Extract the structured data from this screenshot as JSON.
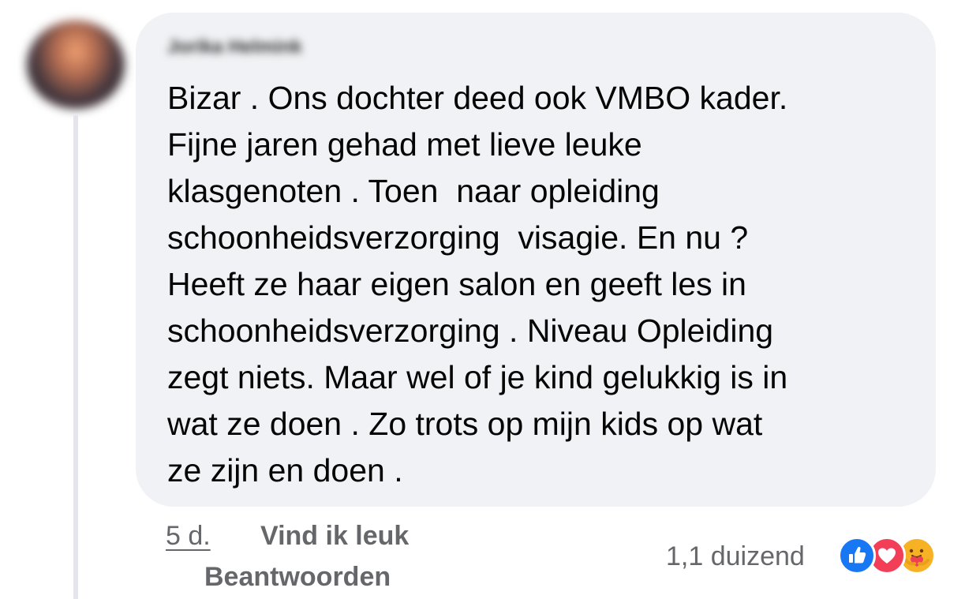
{
  "comment": {
    "author": "Jorika Helmink",
    "text": "Bizar . Ons dochter deed ook VMBO kader.\nFijne jaren gehad met lieve leuke\nklasgenoten . Toen  naar opleiding\nschoonheidsverzorging  visagie. En nu ?\nHeeft ze haar eigen salon en geeft les in\nschoonheidsverzorging . Niveau Opleiding\nzegt niets. Maar wel of je kind gelukkig is in\nwat ze doen . Zo trots op mijn kids op wat\nze zijn en doen ."
  },
  "actions": {
    "time": "5 d.",
    "like_label": "Vind ik leuk",
    "reply_label": "Beantwoorden"
  },
  "reactions": {
    "count": "1,1 duizend",
    "icons": [
      "like-icon",
      "love-icon",
      "care-icon"
    ]
  },
  "colors": {
    "bubble": "#f0f2f5",
    "meta_text": "#65676b",
    "like_blue": "#1877f2",
    "love_red": "#f33e58",
    "care_yellow": "#f7b125"
  }
}
